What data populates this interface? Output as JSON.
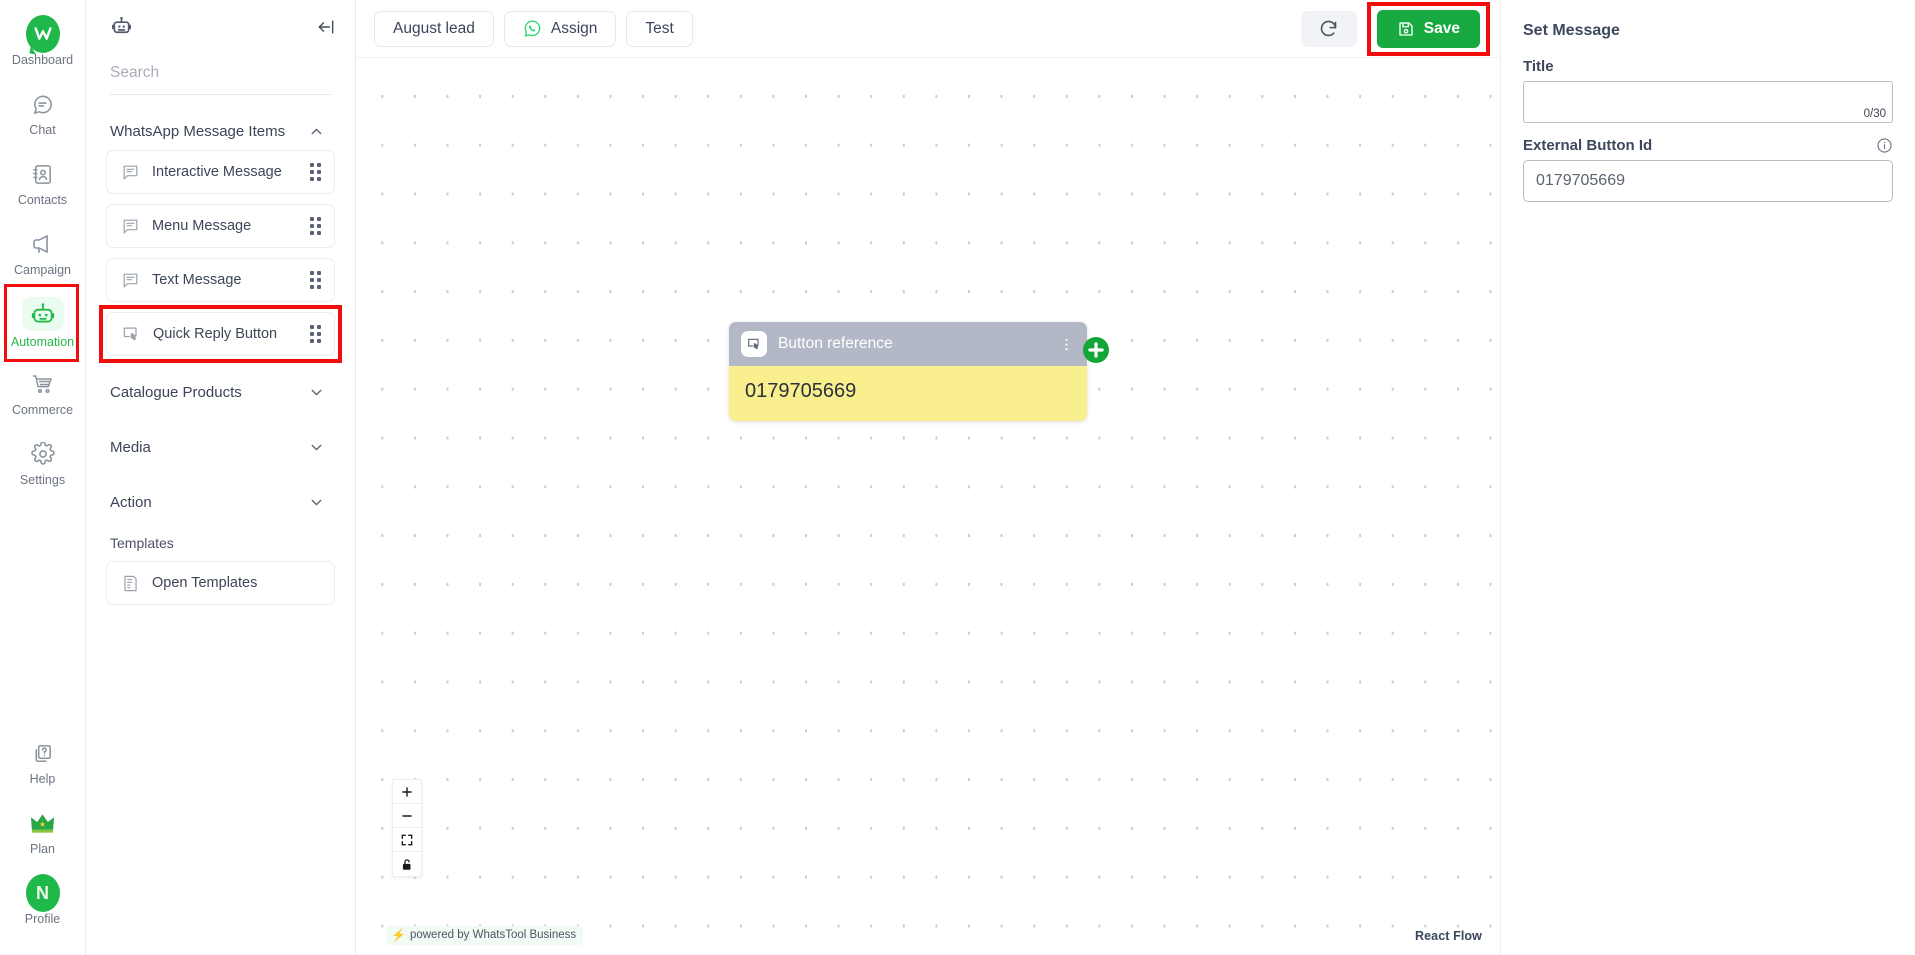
{
  "sidebar": {
    "items": [
      {
        "label": "Dashboard",
        "icon": "whatstool-logo-icon",
        "active": false
      },
      {
        "label": "Chat",
        "icon": "chat-bubble-icon",
        "active": false
      },
      {
        "label": "Contacts",
        "icon": "contacts-book-icon",
        "active": false
      },
      {
        "label": "Campaign",
        "icon": "megaphone-icon",
        "active": false
      },
      {
        "label": "Automation",
        "icon": "robot-icon",
        "active": true
      },
      {
        "label": "Commerce",
        "icon": "shopping-cart-icon",
        "active": false
      },
      {
        "label": "Settings",
        "icon": "gear-icon",
        "active": false
      }
    ],
    "bottom_items": [
      {
        "label": "Help",
        "icon": "help-question-icon"
      },
      {
        "label": "Plan",
        "icon": "crown-icon"
      },
      {
        "label": "Profile",
        "icon": "avatar-icon",
        "avatar_initial": "N"
      }
    ]
  },
  "panel": {
    "header_icon": "robot-icon",
    "collapse_icon": "collapse-left-icon",
    "search": {
      "placeholder": "Search",
      "value": ""
    },
    "sections": [
      {
        "title": "WhatsApp Message Items",
        "expanded": true,
        "chevron": "chevron-up-icon",
        "items": [
          {
            "label": "Interactive Message",
            "icon": "interactive-message-icon",
            "highlighted": false
          },
          {
            "label": "Menu Message",
            "icon": "menu-message-icon",
            "highlighted": false
          },
          {
            "label": "Text Message",
            "icon": "text-message-icon",
            "highlighted": false
          },
          {
            "label": "Quick Reply Button",
            "icon": "quick-reply-button-icon",
            "highlighted": true
          }
        ]
      },
      {
        "title": "Catalogue Products",
        "expanded": false,
        "chevron": "chevron-down-icon",
        "items": []
      },
      {
        "title": "Media",
        "expanded": false,
        "chevron": "chevron-down-icon",
        "items": []
      },
      {
        "title": "Action",
        "expanded": false,
        "chevron": "chevron-down-icon",
        "items": []
      }
    ],
    "templates_label": "Templates",
    "templates_item": {
      "label": "Open Templates",
      "icon": "template-document-icon"
    }
  },
  "topbar": {
    "flow_name": "August lead",
    "assign_label": "Assign",
    "assign_icon": "whatsapp-icon",
    "test_label": "Test",
    "refresh_icon": "refresh-icon",
    "save_label": "Save",
    "save_icon": "floppy-disk-icon",
    "save_color": "#18a941",
    "highlight_color": "#f20d0d"
  },
  "canvas": {
    "node": {
      "title": "Button reference",
      "icon": "quick-reply-button-icon",
      "kebab_icon": "more-vertical-icon",
      "body_text": "0179705669",
      "header_color": "#b2b8c6",
      "body_color": "#faef8e",
      "add_handle_icon": "plus-circle-icon"
    },
    "controls": [
      {
        "name": "zoom-in",
        "icon": "plus-icon"
      },
      {
        "name": "zoom-out",
        "icon": "minus-icon"
      },
      {
        "name": "fit-view",
        "icon": "fit-view-icon"
      },
      {
        "name": "lock",
        "icon": "unlock-icon"
      }
    ],
    "powered_by": "powered by WhatsTool Business",
    "powered_icon": "lightning-bolt-icon",
    "attribution": "React Flow"
  },
  "right_panel": {
    "heading": "Set Message",
    "title_label": "Title",
    "title_value": "",
    "title_placeholder": "",
    "title_counter": "0/30",
    "external_label": "External Button Id",
    "external_value": "0179705669",
    "info_icon": "info-circle-icon"
  }
}
